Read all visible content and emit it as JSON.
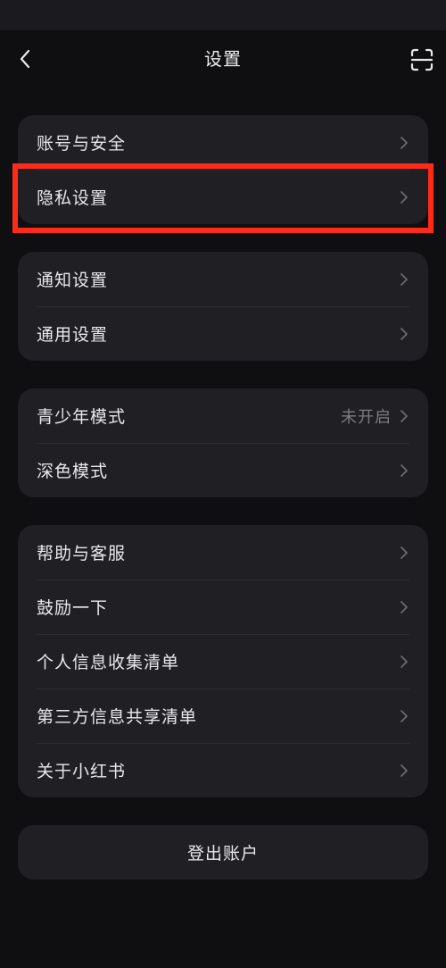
{
  "header": {
    "title": "设置",
    "back_icon": "chevron-left-icon",
    "scan_icon": "scan-icon"
  },
  "groups": [
    {
      "items": [
        {
          "label": "账号与安全"
        },
        {
          "label": "隐私设置"
        }
      ]
    },
    {
      "items": [
        {
          "label": "通知设置"
        },
        {
          "label": "通用设置"
        }
      ]
    },
    {
      "items": [
        {
          "label": "青少年模式",
          "value": "未开启"
        },
        {
          "label": "深色模式"
        }
      ]
    },
    {
      "items": [
        {
          "label": "帮助与客服"
        },
        {
          "label": "鼓励一下"
        },
        {
          "label": "个人信息收集清单"
        },
        {
          "label": "第三方信息共享清单"
        },
        {
          "label": "关于小红书"
        }
      ]
    }
  ],
  "logout": {
    "label": "登出账户"
  },
  "colors": {
    "background": "#0f0f12",
    "card": "#1f1f24",
    "highlight": "#ff2b1a",
    "secondary_text": "#7c7c84"
  }
}
